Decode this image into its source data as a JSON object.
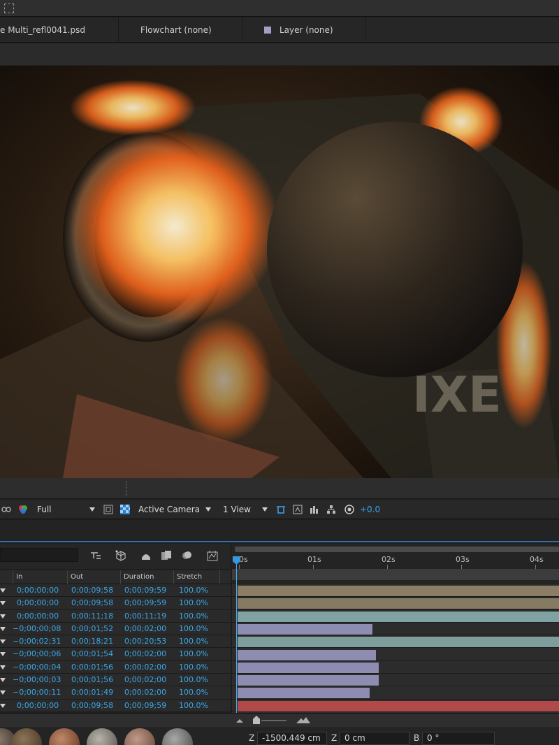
{
  "panel_tabs": {
    "composition": "e Multi_refl0041.psd",
    "flowchart": "Flowchart (none)",
    "layer": "Layer (none)"
  },
  "viewport": {
    "watermark": "IXE"
  },
  "viewer_toolbar": {
    "resolution": "Full",
    "camera": "Active Camera",
    "views": "1 View",
    "exposure": "+0.0"
  },
  "columns": {
    "in": "In",
    "out": "Out",
    "duration": "Duration",
    "stretch": "Stretch"
  },
  "layers": [
    {
      "in": "0;00;00;00",
      "out": "0;00;09;58",
      "duration": "0;00;09;59",
      "stretch": "100.0%",
      "bar_start": 0.0,
      "bar_end": 1.0,
      "color": "#8c7d66"
    },
    {
      "in": "0;00;00;00",
      "out": "0;00;09;58",
      "duration": "0;00;09;59",
      "stretch": "100.0%",
      "bar_start": 0.0,
      "bar_end": 1.0,
      "color": "#857a62"
    },
    {
      "in": "0;00;00;00",
      "out": "0;00;11;18",
      "duration": "0;00;11;19",
      "stretch": "100.0%",
      "bar_start": 0.0,
      "bar_end": 1.0,
      "color": "#7fa2a2"
    },
    {
      "in": "−0;00;00;08",
      "out": "0;00;01;52",
      "duration": "0;00;02;00",
      "stretch": "100.0%",
      "bar_start": 0.0,
      "bar_end": 0.42,
      "color": "#8e8cb0"
    },
    {
      "in": "−0;00;02;31",
      "out": "0;00;18;21",
      "duration": "0;00;20;53",
      "stretch": "100.0%",
      "bar_start": 0.0,
      "bar_end": 1.0,
      "color": "#7e9e9e"
    },
    {
      "in": "−0;00;00;06",
      "out": "0;00;01;54",
      "duration": "0;00;02;00",
      "stretch": "100.0%",
      "bar_start": 0.0,
      "bar_end": 0.43,
      "color": "#8e8cb0"
    },
    {
      "in": "−0;00;00;04",
      "out": "0;00;01;56",
      "duration": "0;00;02;00",
      "stretch": "100.0%",
      "bar_start": 0.0,
      "bar_end": 0.44,
      "color": "#8e8cb0"
    },
    {
      "in": "−0;00;00;03",
      "out": "0;00;01;56",
      "duration": "0;00;02;00",
      "stretch": "100.0%",
      "bar_start": 0.0,
      "bar_end": 0.44,
      "color": "#8e8cb0"
    },
    {
      "in": "−0;00;00;11",
      "out": "0;00;01;49",
      "duration": "0;00;02;00",
      "stretch": "100.0%",
      "bar_start": 0.0,
      "bar_end": 0.41,
      "color": "#8e8cb0"
    },
    {
      "in": "0;00;00;00",
      "out": "0;00;09;58",
      "duration": "0;00;09;59",
      "stretch": "100.0%",
      "bar_start": 0.0,
      "bar_end": 1.0,
      "color": "#b04a4a"
    }
  ],
  "ruler": {
    "ticks": [
      "0s",
      "01s",
      "02s",
      "03s",
      "04s"
    ]
  },
  "bottom_fields": {
    "z_label": "Z",
    "z_value": "-1500.449 cm",
    "z2_label": "Z",
    "z2_value": "0 cm",
    "b_label": "B",
    "b_value": "0 °"
  }
}
